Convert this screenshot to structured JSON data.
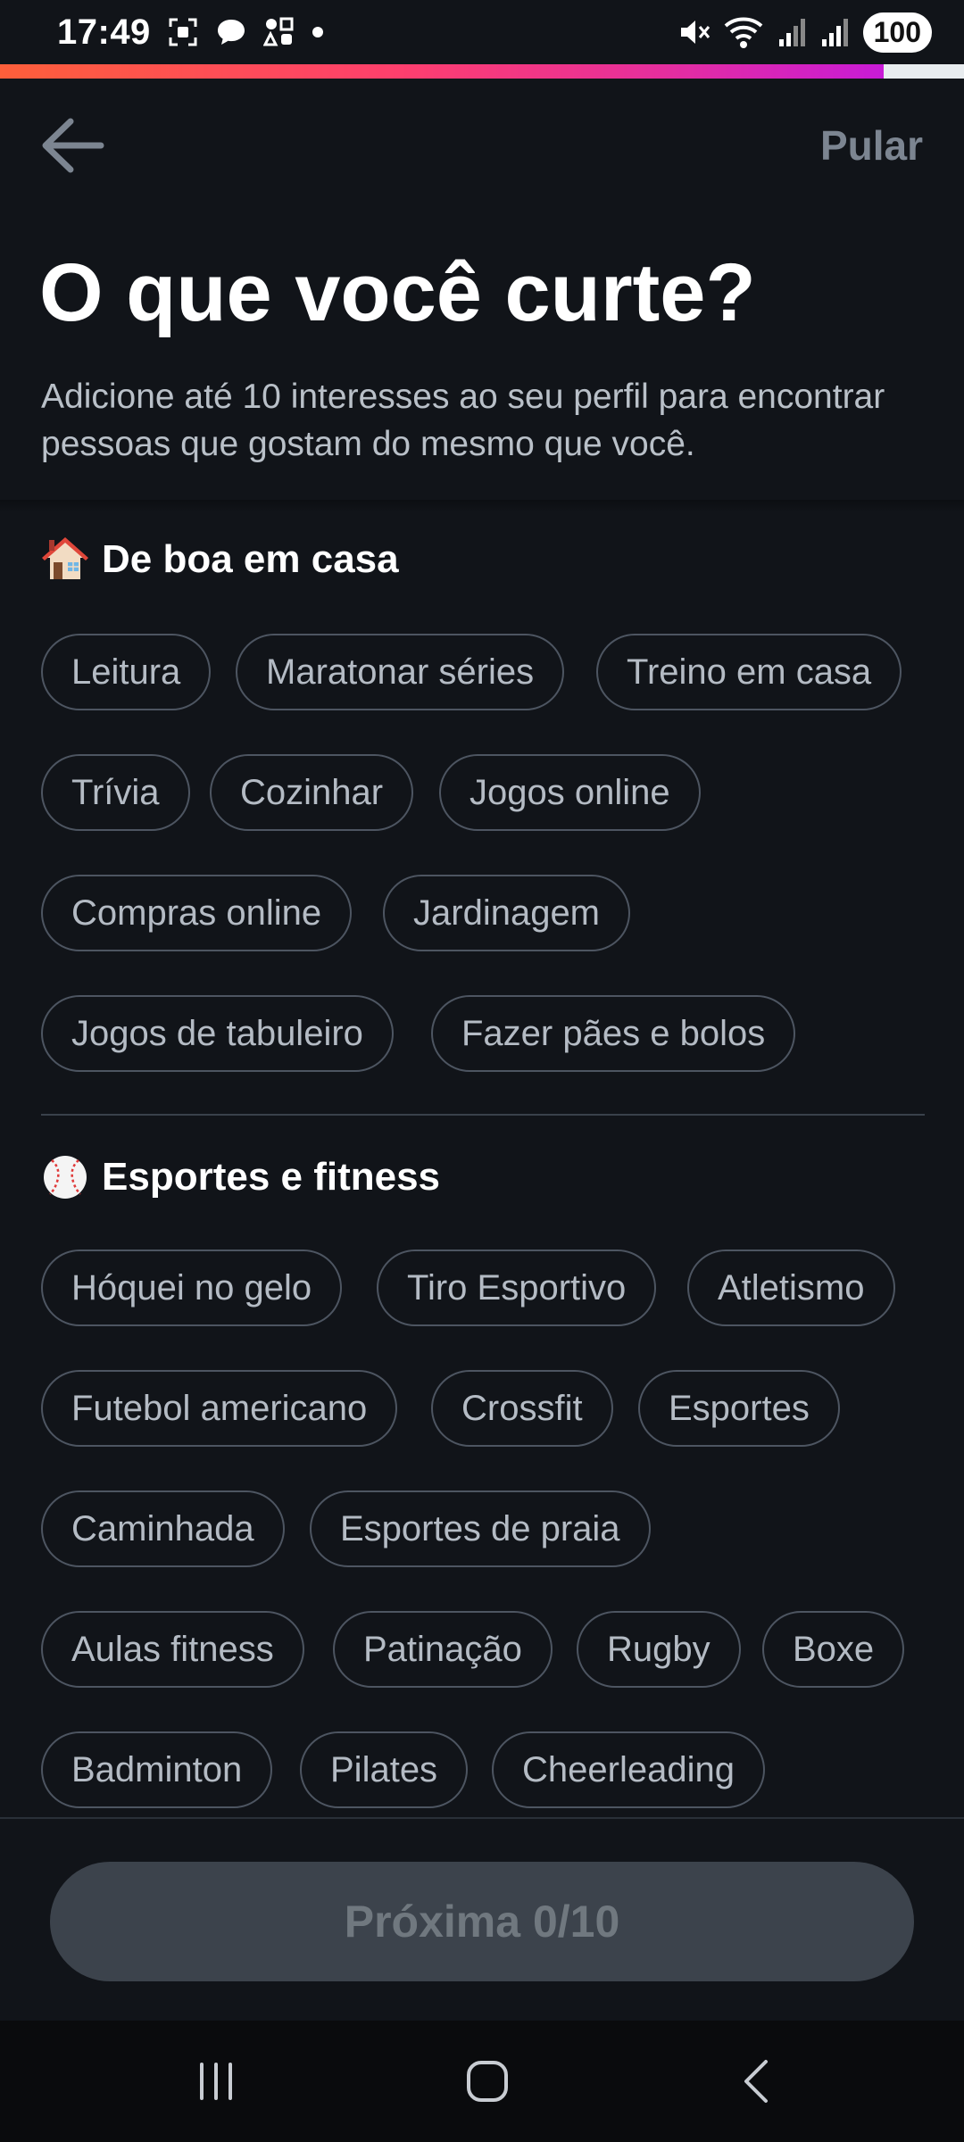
{
  "status_bar": {
    "time": "17:49",
    "battery": "100",
    "icons": [
      "screenshot-icon",
      "chat-bubble-icon",
      "shape-share-icon",
      "dot-icon",
      "mute-icon",
      "wifi-icon",
      "signal-1-icon",
      "signal-2-icon"
    ]
  },
  "progress": {
    "fraction": 0.917,
    "fill_colors": [
      "#fd5f3a",
      "#fe3f6d",
      "#e52e9e",
      "#c81bd6"
    ]
  },
  "nav": {
    "skip_label": "Pular"
  },
  "header": {
    "title": "O que você curte?",
    "subtitle": "Adicione até 10 interesses ao seu perfil para encontrar pessoas que gostam do mesmo que você."
  },
  "sections": [
    {
      "emoji_icon": "house-icon",
      "title": "De boa em casa",
      "chips": [
        "Leitura",
        "Maratonar séries",
        "Treino em casa",
        "Trívia",
        "Cozinhar",
        "Jogos online",
        "Compras online",
        "Jardinagem",
        "Jogos de tabuleiro",
        "Fazer pães e bolos"
      ]
    },
    {
      "emoji_icon": "baseball-icon",
      "title": "Esportes e fitness",
      "chips": [
        "Hóquei no gelo",
        "Tiro Esportivo",
        "Atletismo",
        "Futebol americano",
        "Crossfit",
        "Esportes",
        "Caminhada",
        "Esportes de praia",
        "Aulas fitness",
        "Patinação",
        "Rugby",
        "Boxe",
        "Badminton",
        "Pilates",
        "Cheerleading"
      ]
    }
  ],
  "footer": {
    "next_label": "Próxima 0/10",
    "selected_count": 0,
    "max_count": 10
  },
  "system_nav": {
    "icons": [
      "recents-icon",
      "home-icon",
      "back-nav-icon"
    ]
  },
  "colors": {
    "background": "#111419",
    "chip_border": "#4d5561",
    "chip_text": "#b4bbc4",
    "skip_text": "#7c8591",
    "button_disabled_bg": "#3c434c",
    "button_disabled_text": "#70787f"
  }
}
